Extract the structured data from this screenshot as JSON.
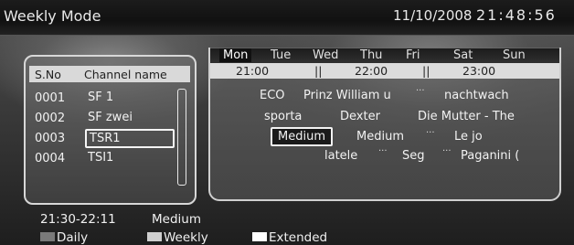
{
  "header": {
    "title": "Weekly Mode",
    "date": "11/10/2008",
    "time": "21:48:56"
  },
  "channels": {
    "header_no": "S.No",
    "header_name": "Channel name",
    "rows": [
      {
        "no": "0001",
        "name": "SF 1"
      },
      {
        "no": "0002",
        "name": "SF zwei"
      },
      {
        "no": "0003",
        "name": "TSR1"
      },
      {
        "no": "0004",
        "name": "TSI1"
      }
    ],
    "selected_index": 2
  },
  "epg": {
    "days": [
      "Mon",
      "Tue",
      "Wed",
      "Thu",
      "Fri",
      "Sat",
      "Sun"
    ],
    "active_day": "Mon",
    "times": [
      "21:00",
      "22:00",
      "23:00"
    ],
    "separator": "||",
    "row1": {
      "a": "ECO",
      "b": "Prinz William u",
      "dots": "···",
      "c": "nachtwach"
    },
    "row2": {
      "a": "sporta",
      "b": "Dexter",
      "c": "Die Mutter - The"
    },
    "row3": {
      "a": "Medium",
      "b": "Medium",
      "dots": "···",
      "c": "Le jo"
    },
    "row4": {
      "a": "latele",
      "dots1": "···",
      "b": "Seg",
      "dots2": "···",
      "c": "Paganini ("
    }
  },
  "info": {
    "time_range": "21:30-22:11",
    "program": "Medium"
  },
  "legend": {
    "daily": {
      "label": "Daily",
      "color": "#7a7a7a"
    },
    "weekly": {
      "label": "Weekly",
      "color": "#cfcfcf"
    },
    "extended": {
      "label": "Extended",
      "color": "#ffffff"
    }
  }
}
